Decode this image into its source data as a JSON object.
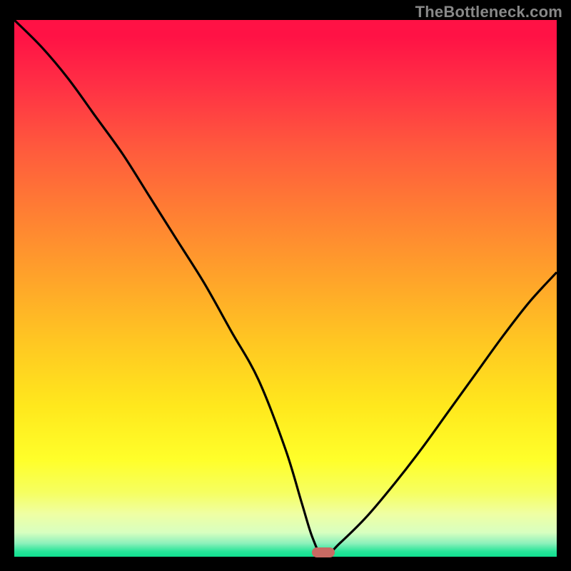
{
  "watermark": "TheBottleneck.com",
  "colors": {
    "curve_stroke": "#000000",
    "marker_fill": "#c96a63",
    "frame_bg": "#000000"
  },
  "chart_data": {
    "type": "line",
    "title": "",
    "xlabel": "",
    "ylabel": "",
    "xlim": [
      0,
      100
    ],
    "ylim": [
      0,
      100
    ],
    "grid": false,
    "series": [
      {
        "name": "bottleneck-curve",
        "x": [
          0,
          5,
          10,
          15,
          20,
          25,
          30,
          35,
          40,
          45,
          50,
          53,
          55,
          57,
          60,
          65,
          70,
          75,
          80,
          85,
          90,
          95,
          100
        ],
        "values": [
          100,
          95,
          89,
          82,
          75,
          67,
          59,
          51,
          42,
          33,
          20,
          10,
          3.5,
          0.0,
          2.5,
          7.5,
          13.5,
          20.0,
          27.0,
          34.0,
          41.0,
          47.5,
          53.0
        ]
      }
    ],
    "annotations": [
      {
        "name": "optimal-marker",
        "x": 57,
        "y": 0.8
      }
    ]
  }
}
